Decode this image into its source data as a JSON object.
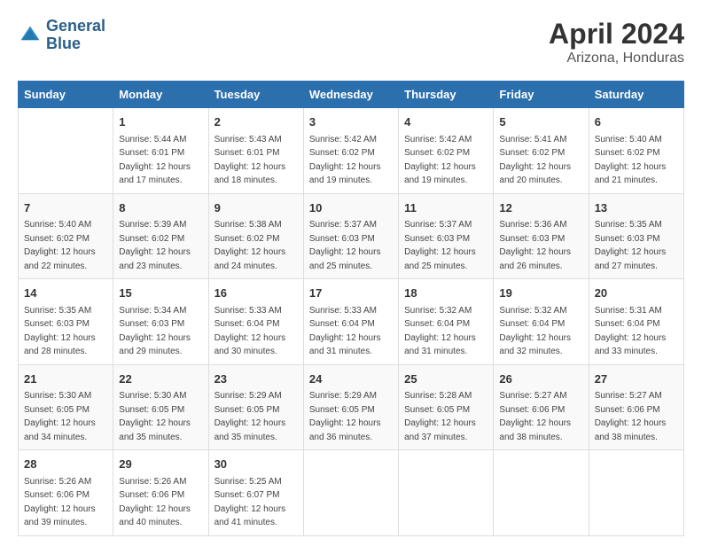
{
  "header": {
    "logo_line1": "General",
    "logo_line2": "Blue",
    "month_year": "April 2024",
    "location": "Arizona, Honduras"
  },
  "days_of_week": [
    "Sunday",
    "Monday",
    "Tuesday",
    "Wednesday",
    "Thursday",
    "Friday",
    "Saturday"
  ],
  "weeks": [
    [
      {
        "day": "",
        "info": ""
      },
      {
        "day": "1",
        "info": "Sunrise: 5:44 AM\nSunset: 6:01 PM\nDaylight: 12 hours\nand 17 minutes."
      },
      {
        "day": "2",
        "info": "Sunrise: 5:43 AM\nSunset: 6:01 PM\nDaylight: 12 hours\nand 18 minutes."
      },
      {
        "day": "3",
        "info": "Sunrise: 5:42 AM\nSunset: 6:02 PM\nDaylight: 12 hours\nand 19 minutes."
      },
      {
        "day": "4",
        "info": "Sunrise: 5:42 AM\nSunset: 6:02 PM\nDaylight: 12 hours\nand 19 minutes."
      },
      {
        "day": "5",
        "info": "Sunrise: 5:41 AM\nSunset: 6:02 PM\nDaylight: 12 hours\nand 20 minutes."
      },
      {
        "day": "6",
        "info": "Sunrise: 5:40 AM\nSunset: 6:02 PM\nDaylight: 12 hours\nand 21 minutes."
      }
    ],
    [
      {
        "day": "7",
        "info": "Sunrise: 5:40 AM\nSunset: 6:02 PM\nDaylight: 12 hours\nand 22 minutes."
      },
      {
        "day": "8",
        "info": "Sunrise: 5:39 AM\nSunset: 6:02 PM\nDaylight: 12 hours\nand 23 minutes."
      },
      {
        "day": "9",
        "info": "Sunrise: 5:38 AM\nSunset: 6:02 PM\nDaylight: 12 hours\nand 24 minutes."
      },
      {
        "day": "10",
        "info": "Sunrise: 5:37 AM\nSunset: 6:03 PM\nDaylight: 12 hours\nand 25 minutes."
      },
      {
        "day": "11",
        "info": "Sunrise: 5:37 AM\nSunset: 6:03 PM\nDaylight: 12 hours\nand 25 minutes."
      },
      {
        "day": "12",
        "info": "Sunrise: 5:36 AM\nSunset: 6:03 PM\nDaylight: 12 hours\nand 26 minutes."
      },
      {
        "day": "13",
        "info": "Sunrise: 5:35 AM\nSunset: 6:03 PM\nDaylight: 12 hours\nand 27 minutes."
      }
    ],
    [
      {
        "day": "14",
        "info": "Sunrise: 5:35 AM\nSunset: 6:03 PM\nDaylight: 12 hours\nand 28 minutes."
      },
      {
        "day": "15",
        "info": "Sunrise: 5:34 AM\nSunset: 6:03 PM\nDaylight: 12 hours\nand 29 minutes."
      },
      {
        "day": "16",
        "info": "Sunrise: 5:33 AM\nSunset: 6:04 PM\nDaylight: 12 hours\nand 30 minutes."
      },
      {
        "day": "17",
        "info": "Sunrise: 5:33 AM\nSunset: 6:04 PM\nDaylight: 12 hours\nand 31 minutes."
      },
      {
        "day": "18",
        "info": "Sunrise: 5:32 AM\nSunset: 6:04 PM\nDaylight: 12 hours\nand 31 minutes."
      },
      {
        "day": "19",
        "info": "Sunrise: 5:32 AM\nSunset: 6:04 PM\nDaylight: 12 hours\nand 32 minutes."
      },
      {
        "day": "20",
        "info": "Sunrise: 5:31 AM\nSunset: 6:04 PM\nDaylight: 12 hours\nand 33 minutes."
      }
    ],
    [
      {
        "day": "21",
        "info": "Sunrise: 5:30 AM\nSunset: 6:05 PM\nDaylight: 12 hours\nand 34 minutes."
      },
      {
        "day": "22",
        "info": "Sunrise: 5:30 AM\nSunset: 6:05 PM\nDaylight: 12 hours\nand 35 minutes."
      },
      {
        "day": "23",
        "info": "Sunrise: 5:29 AM\nSunset: 6:05 PM\nDaylight: 12 hours\nand 35 minutes."
      },
      {
        "day": "24",
        "info": "Sunrise: 5:29 AM\nSunset: 6:05 PM\nDaylight: 12 hours\nand 36 minutes."
      },
      {
        "day": "25",
        "info": "Sunrise: 5:28 AM\nSunset: 6:05 PM\nDaylight: 12 hours\nand 37 minutes."
      },
      {
        "day": "26",
        "info": "Sunrise: 5:27 AM\nSunset: 6:06 PM\nDaylight: 12 hours\nand 38 minutes."
      },
      {
        "day": "27",
        "info": "Sunrise: 5:27 AM\nSunset: 6:06 PM\nDaylight: 12 hours\nand 38 minutes."
      }
    ],
    [
      {
        "day": "28",
        "info": "Sunrise: 5:26 AM\nSunset: 6:06 PM\nDaylight: 12 hours\nand 39 minutes."
      },
      {
        "day": "29",
        "info": "Sunrise: 5:26 AM\nSunset: 6:06 PM\nDaylight: 12 hours\nand 40 minutes."
      },
      {
        "day": "30",
        "info": "Sunrise: 5:25 AM\nSunset: 6:07 PM\nDaylight: 12 hours\nand 41 minutes."
      },
      {
        "day": "",
        "info": ""
      },
      {
        "day": "",
        "info": ""
      },
      {
        "day": "",
        "info": ""
      },
      {
        "day": "",
        "info": ""
      }
    ]
  ]
}
